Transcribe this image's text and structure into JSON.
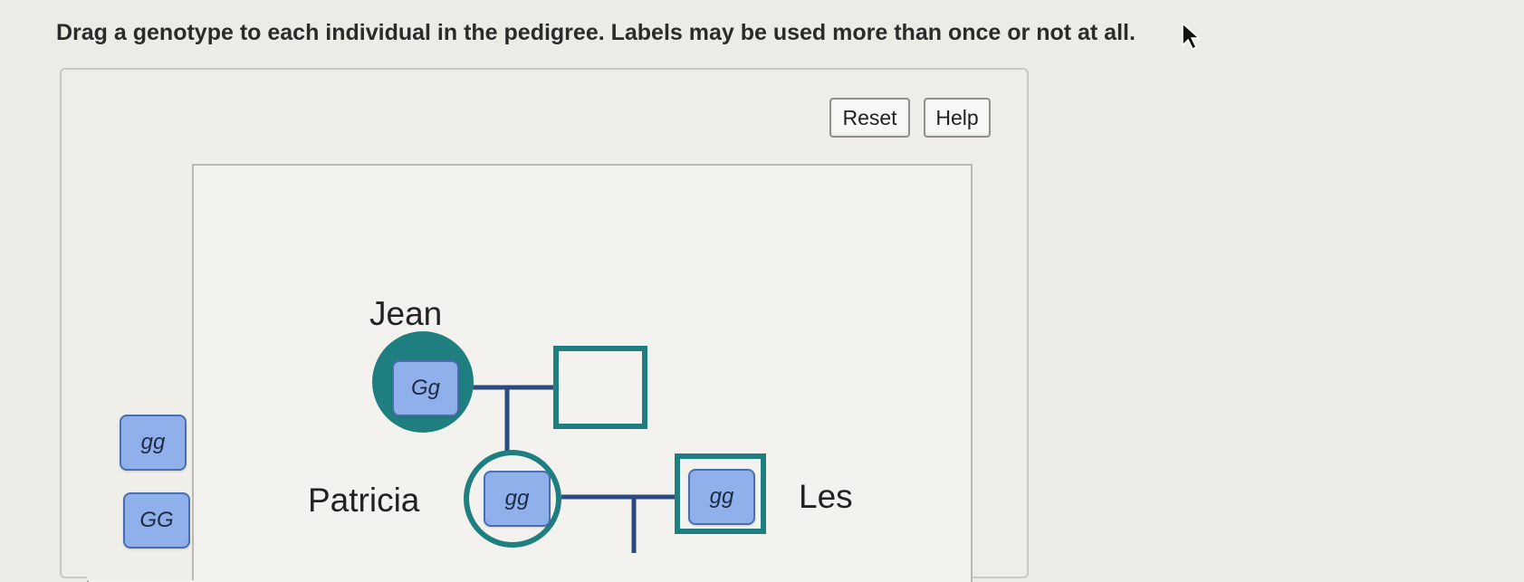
{
  "instructions": "Drag a genotype to each individual in the pedigree. Labels may be used more than once or not at all.",
  "buttons": {
    "reset": "Reset",
    "help": "Help"
  },
  "label_bank": [
    "gg",
    "GG"
  ],
  "pedigree": {
    "names": {
      "jean": "Jean",
      "patricia": "Patricia",
      "les": "Les"
    },
    "placed": {
      "jean": "Gg",
      "patricia": "gg",
      "les": "gg"
    }
  },
  "colors": {
    "teal": "#1f7f80",
    "line": "#2b4a7e",
    "chip": "#8fb0ea",
    "chip_border": "#4a6fb0"
  },
  "icons": {
    "cursor": "arrow-pointer-icon"
  }
}
